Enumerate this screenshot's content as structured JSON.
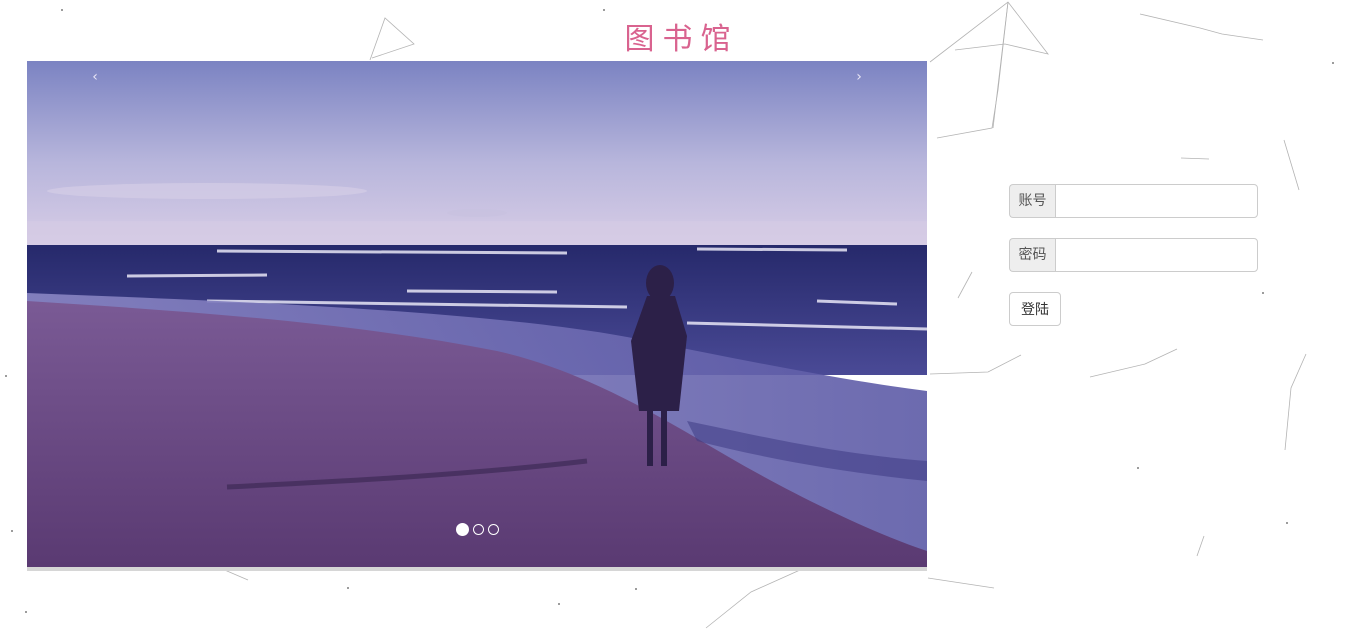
{
  "header": {
    "title": "图书馆"
  },
  "carousel": {
    "prev_symbol": "‹",
    "next_symbol": "›",
    "slide_count": 3,
    "active_index": 0
  },
  "login": {
    "account_label": "账号",
    "account_value": "",
    "password_label": "密码",
    "password_value": "",
    "submit_label": "登陆"
  },
  "colors": {
    "title": "#d9638f",
    "sky_top": "#7e86c3",
    "sea": "#34347a",
    "sand": "#6e4c84"
  }
}
